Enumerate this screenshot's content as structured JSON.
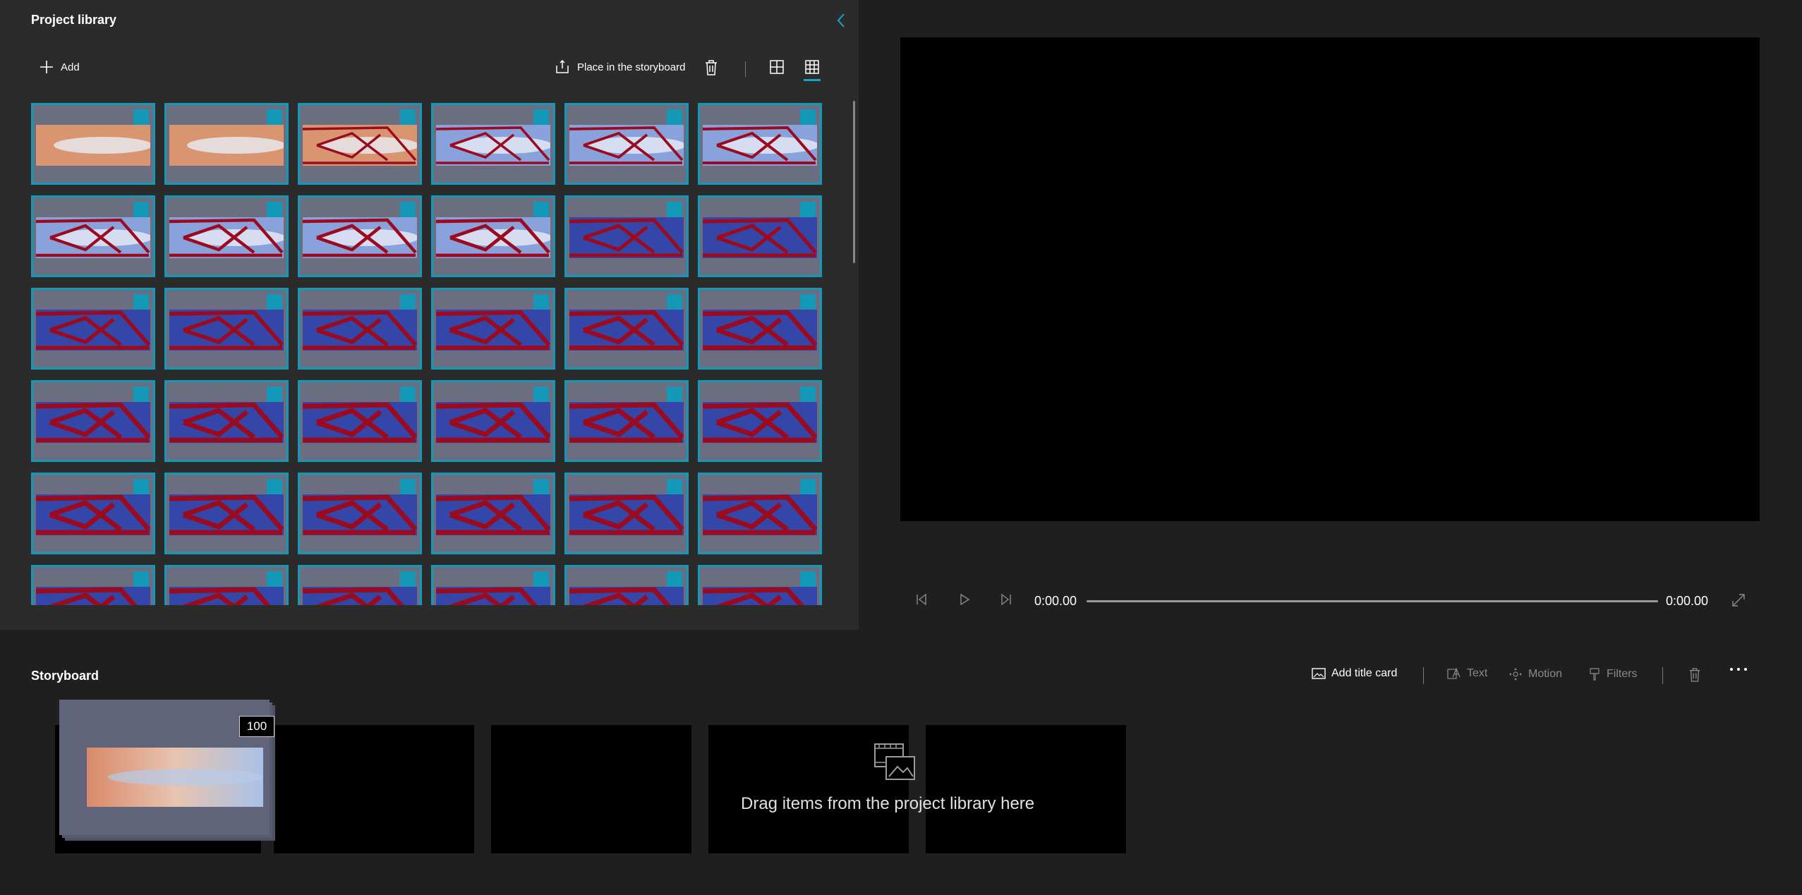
{
  "library": {
    "title": "Project library",
    "add_label": "Add",
    "place_label": "Place in the storyboard",
    "collapse_icon": "chevron-left-icon",
    "tiles_rows": 6,
    "tiles_cols": 6
  },
  "player": {
    "current_time": "0:00.00",
    "total_time": "0:00.00"
  },
  "storyboard": {
    "title": "Storyboard",
    "add_title_card_label": "Add title card",
    "text_label": "Text",
    "motion_label": "Motion",
    "filters_label": "Filters",
    "selected_count": "100",
    "drop_hint": "Drag items from the project library here"
  },
  "colors": {
    "accent": "#1498b8",
    "panel": "#2b2b2b",
    "background": "#1f1f1f",
    "heat_red": "#9b0b1f",
    "heat_blue": "#3447a8"
  }
}
